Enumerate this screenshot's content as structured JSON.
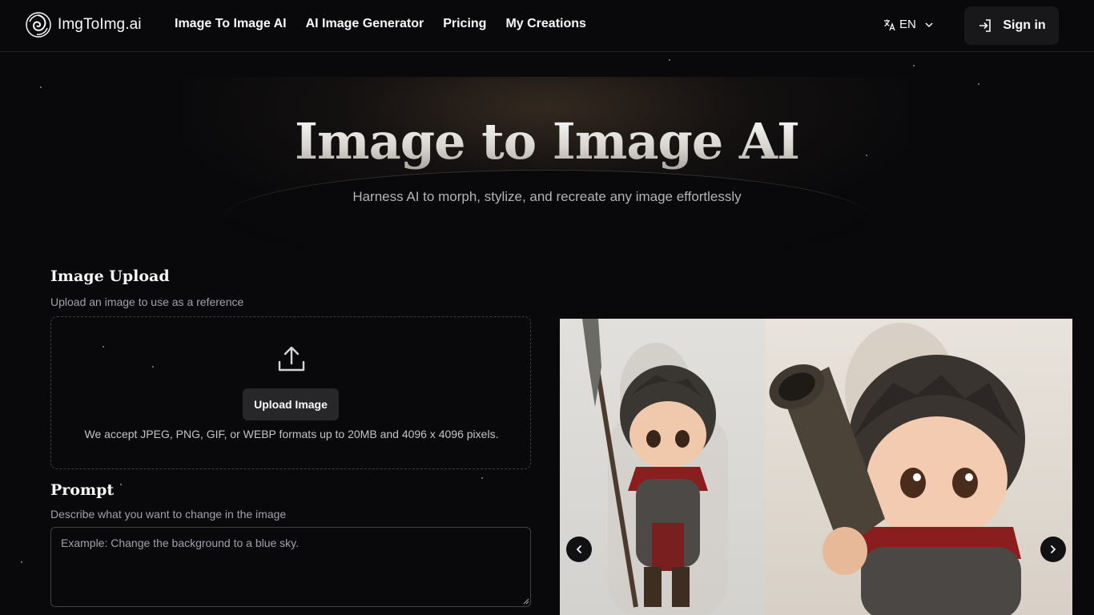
{
  "header": {
    "logo_text": "ImgToImg.ai",
    "nav": [
      {
        "label": "Image To Image AI"
      },
      {
        "label": "AI Image Generator"
      },
      {
        "label": "Pricing"
      },
      {
        "label": "My Creations"
      }
    ],
    "language": "EN",
    "signin_label": "Sign in"
  },
  "hero": {
    "title": "Image to Image AI",
    "subtitle": "Harness AI to morph, stylize, and recreate any image effortlessly"
  },
  "upload": {
    "title": "Image Upload",
    "description": "Upload an image to use as a reference",
    "button_label": "Upload Image",
    "note": "We accept JPEG, PNG, GIF, or WEBP formats up to 20MB and 4096 x 4096 pixels."
  },
  "prompt": {
    "title": "Prompt",
    "description": "Describe what you want to change in the image",
    "placeholder": "Example: Change the background to a blue sky."
  },
  "carousel": {
    "icons": {
      "prev": "chevron-left-icon",
      "next": "chevron-right-icon"
    }
  },
  "colors": {
    "background": "#09090b",
    "surface": "#18181b",
    "button": "#27272a",
    "muted_text": "#a1a1aa"
  }
}
